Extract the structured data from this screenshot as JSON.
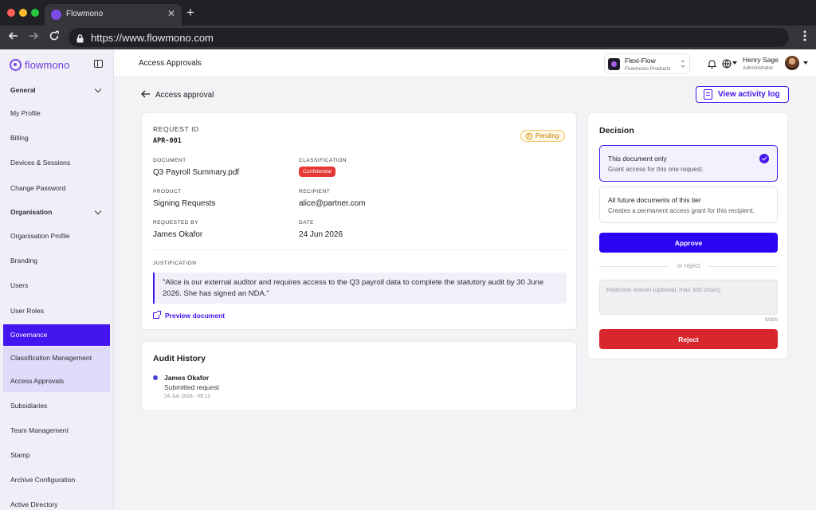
{
  "browser": {
    "tab_title": "Flowmono",
    "close_glyph": "✕",
    "new_tab_glyph": "+",
    "url": "https://www.flowmono.com"
  },
  "sidebar": {
    "brand": "flowmono",
    "sections": [
      {
        "label": "General",
        "items": [
          "My Profile",
          "Billing",
          "Devices & Sessions",
          "Change Password"
        ]
      },
      {
        "label": "Organisation",
        "items": [
          "Organisation Profile",
          "Branding",
          "Users",
          "User Roles",
          "Governance",
          "Classification Management",
          "Access Approvals",
          "Subsidiaries",
          "Team Management",
          "Stamp",
          "Archive Configuration",
          "Active Directory"
        ]
      }
    ]
  },
  "header": {
    "page_title": "Access Approvals",
    "workspace_name": "Flexi-Flow",
    "workspace_sub": "Flowmono Products",
    "user_name": "Henry Sage",
    "user_role": "Administrator"
  },
  "main": {
    "back_label": "Access approval",
    "activity_button": "View activity log",
    "request": {
      "id_label": "REQUEST ID",
      "id_value": "APR-001",
      "status": "Pending",
      "document_label": "DOCUMENT",
      "document_value": "Q3 Payroll Summary.pdf",
      "classification_label": "CLASSIFICATION",
      "classification_value": "Confidential",
      "product_label": "PRODUCT",
      "product_value": "Signing Requests",
      "recipient_label": "RECIPIENT",
      "recipient_value": "alice@partner.com",
      "requested_by_label": "REQUESTED BY",
      "requested_by_value": "James Okafor",
      "date_label": "DATE",
      "date_value": "24 Jun 2026",
      "justification_label": "JUSTIFICATION",
      "justification_text": "\"Alice is our external auditor and requires access to the Q3 payroll data to complete the statutory audit by 30 June 2026. She has signed an NDA.\"",
      "preview_link": "Preview document"
    },
    "audit": {
      "title": "Audit History",
      "entries": [
        {
          "name": "James Okafor",
          "action": "Submitted request",
          "time": "24 Jun 2026 · 09:12"
        }
      ]
    },
    "decision": {
      "title": "Decision",
      "options": [
        {
          "title": "This document only",
          "desc": "Grant access for this one request.",
          "selected": true
        },
        {
          "title": "All future documents of this tier",
          "desc": "Creates a permanent access grant for this recipient.",
          "selected": false
        }
      ],
      "approve_label": "Approve",
      "or_label": "or reject",
      "reject_placeholder": "Rejection reason (optional, max 300 chars)",
      "counter": "0/300",
      "reject_label": "Reject"
    }
  },
  "colors": {
    "accent": "#4515f0",
    "danger": "#d7262c",
    "pending": "#c07a00",
    "brand": "#7b4be6"
  }
}
